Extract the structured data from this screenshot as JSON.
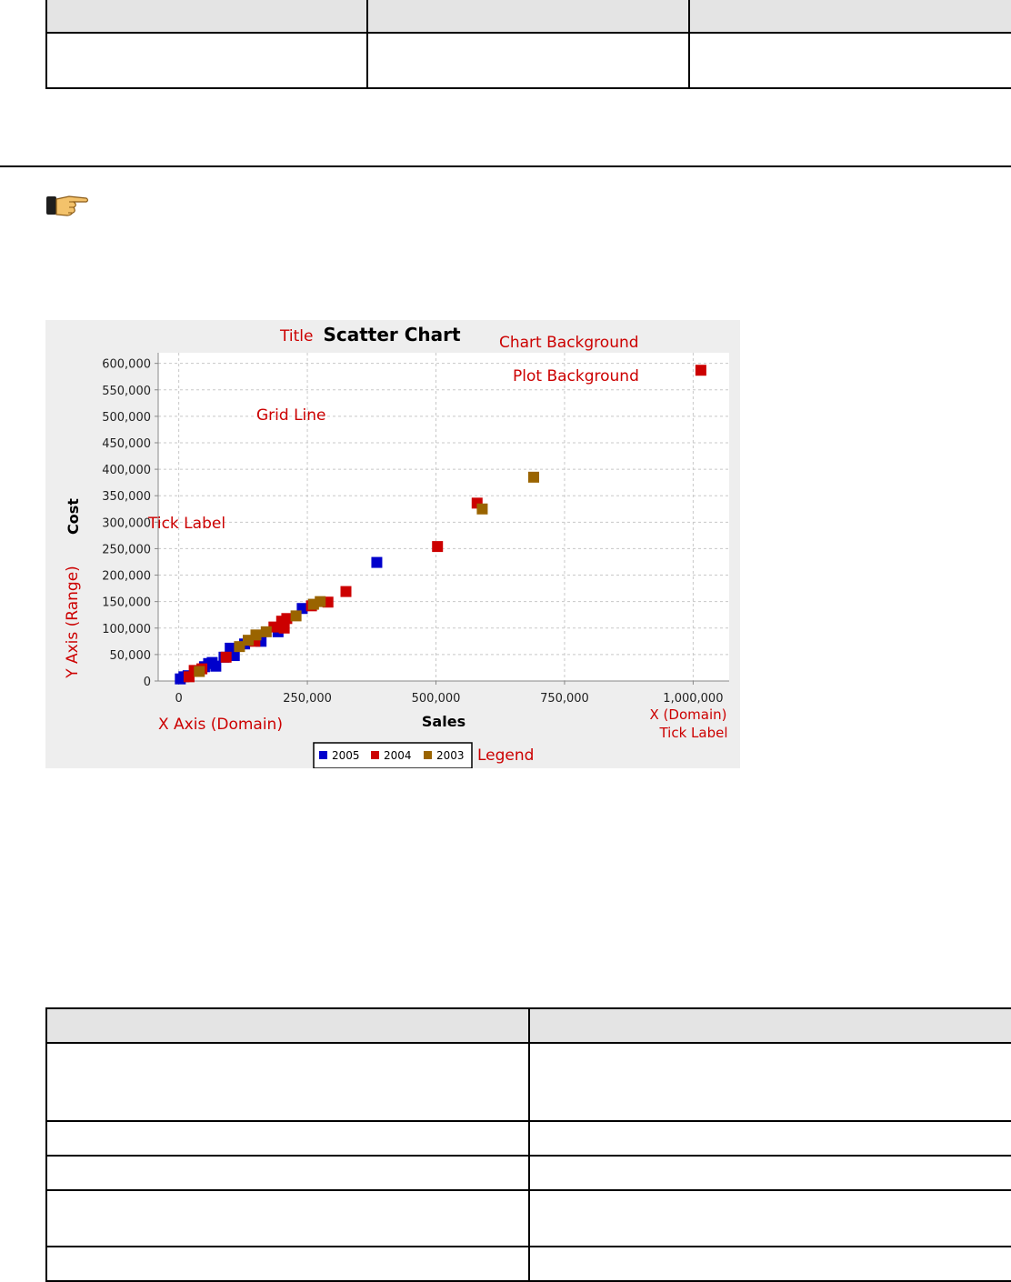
{
  "top_table": {
    "headers": [
      "",
      "",
      ""
    ],
    "rows": [
      [
        "",
        "",
        ""
      ]
    ]
  },
  "note_icon": "pointing-hand-icon",
  "chart_data": {
    "type": "scatter",
    "title": "Scatter Chart",
    "xlabel": "Sales",
    "ylabel": "Cost",
    "xlim": [
      -40000,
      1070000
    ],
    "ylim": [
      0,
      620000
    ],
    "xticks": [
      0,
      250000,
      500000,
      750000,
      1000000
    ],
    "xtick_labels": [
      "0",
      "250,000",
      "500,000",
      "750,000",
      "1,000,000"
    ],
    "yticks": [
      0,
      50000,
      100000,
      150000,
      200000,
      250000,
      300000,
      350000,
      400000,
      450000,
      500000,
      550000,
      600000
    ],
    "ytick_labels": [
      "0",
      "50,000",
      "100,000",
      "150,000",
      "200,000",
      "250,000",
      "300,000",
      "350,000",
      "400,000",
      "450,000",
      "500,000",
      "550,000",
      "600,000"
    ],
    "grid": true,
    "legend_position": "bottom",
    "series": [
      {
        "name": "2005",
        "color": "#0000cc",
        "points": [
          [
            3000,
            4000
          ],
          [
            10000,
            8000
          ],
          [
            18000,
            10000
          ],
          [
            50000,
            27000
          ],
          [
            58000,
            33000
          ],
          [
            65000,
            35000
          ],
          [
            72000,
            28000
          ],
          [
            88000,
            45000
          ],
          [
            100000,
            62000
          ],
          [
            108000,
            48000
          ],
          [
            128000,
            70000
          ],
          [
            160000,
            75000
          ],
          [
            193000,
            93000
          ],
          [
            240000,
            137000
          ],
          [
            385000,
            224000
          ]
        ]
      },
      {
        "name": "2004",
        "color": "#cc0000",
        "points": [
          [
            20000,
            8000
          ],
          [
            30000,
            20000
          ],
          [
            45000,
            23000
          ],
          [
            92000,
            45000
          ],
          [
            148000,
            75000
          ],
          [
            185000,
            102000
          ],
          [
            200000,
            113000
          ],
          [
            205000,
            100000
          ],
          [
            210000,
            118000
          ],
          [
            258000,
            142000
          ],
          [
            290000,
            149000
          ],
          [
            325000,
            169000
          ],
          [
            503000,
            254000
          ],
          [
            580000,
            336000
          ],
          [
            1015000,
            587000
          ]
        ]
      },
      {
        "name": "2003",
        "color": "#9a6400",
        "points": [
          [
            40000,
            18000
          ],
          [
            118000,
            65000
          ],
          [
            135000,
            77000
          ],
          [
            150000,
            87000
          ],
          [
            170000,
            93000
          ],
          [
            228000,
            123000
          ],
          [
            262000,
            145000
          ],
          [
            275000,
            150000
          ],
          [
            590000,
            325000
          ],
          [
            690000,
            385000
          ]
        ]
      }
    ],
    "annotations": [
      {
        "text": "Title",
        "near": "title-left"
      },
      {
        "text": "Chart Background",
        "near": "top-right"
      },
      {
        "text": "Plot Background",
        "near": "top-right-inner"
      },
      {
        "text": "Grid Line",
        "near": "upper-left-plot"
      },
      {
        "text": "Tick Label",
        "near": "y-axis-ticks"
      },
      {
        "text": "Y Axis (Range)",
        "near": "y-axis"
      },
      {
        "text": "X Axis (Domain)",
        "near": "x-axis-left"
      },
      {
        "text": "X (Domain)",
        "near": "x-axis-right"
      },
      {
        "text": "Tick Label",
        "near": "x-axis-right"
      },
      {
        "text": "Legend",
        "near": "legend"
      }
    ],
    "annotation_color": "#cc0000"
  },
  "bottom_table": {
    "headers": [
      "",
      ""
    ],
    "rows": [
      [
        "",
        ""
      ],
      [
        "",
        ""
      ],
      [
        "",
        ""
      ],
      [
        "",
        ""
      ],
      [
        "",
        ""
      ]
    ]
  }
}
